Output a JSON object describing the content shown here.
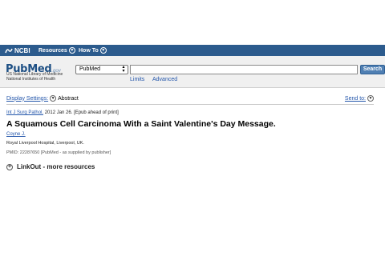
{
  "header": {
    "ncbi_label": "NCBI",
    "nav": [
      {
        "label": "Resources"
      },
      {
        "label": "How To"
      }
    ]
  },
  "pubmed_logo": {
    "pub": "Pub",
    "med": "Med",
    "gov": ".gov",
    "org_line1": "US National Library of Medicine",
    "org_line2": "National Institutes of Health"
  },
  "search": {
    "database": "PubMed",
    "query": "",
    "placeholder": "",
    "button_label": "Search",
    "limits_label": "Limits",
    "advanced_label": "Advanced"
  },
  "toolbar": {
    "display_settings_label": "Display Settings:",
    "display_format": "Abstract",
    "send_to_label": "Send to:"
  },
  "article": {
    "journal": "Int J Surg Pathol.",
    "date_note": "2012 Jan 26. [Epub ahead of print]",
    "title": "A Squamous Cell Carcinoma With a Saint Valentine's Day Message.",
    "author": "Coyne J.",
    "affiliation": "Royal Liverpool Hospital, Liverpool, UK.",
    "pmid_line": "PMID: 22287650 [PubMed - as supplied by publisher]",
    "linkout_label": "LinkOut - more resources"
  },
  "colors": {
    "ncbi_bar": "#2c5b8d",
    "link": "#2255aa",
    "search_button": "#4f7fb3"
  }
}
